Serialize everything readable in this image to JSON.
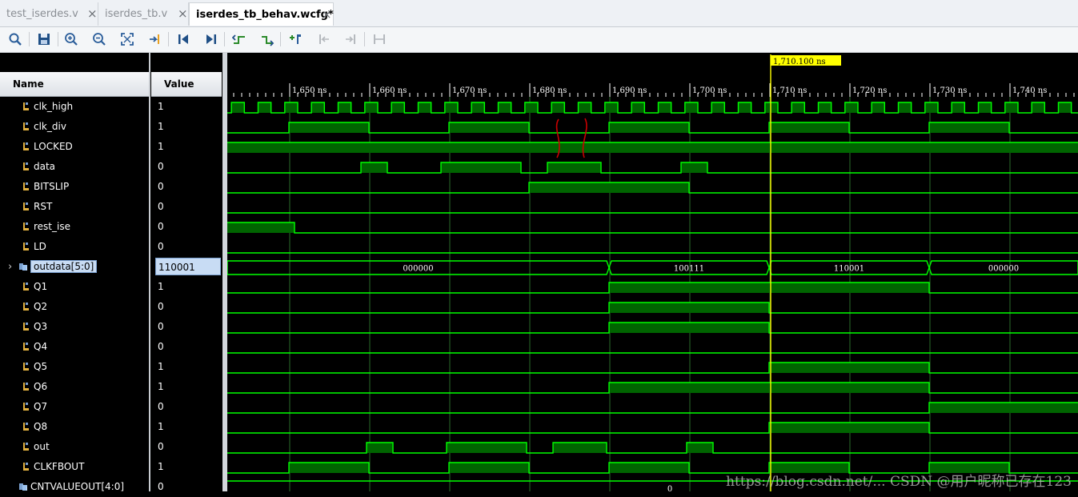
{
  "tabs": [
    {
      "label": "test_iserdes.v"
    },
    {
      "label": "iserdes_tb.v"
    },
    {
      "label": "iserdes_tb_behav.wcfg*"
    }
  ],
  "tab_close_glyph": "×",
  "toolbar_icons": [
    "search-icon",
    "save-icon",
    "zoom-in-icon",
    "zoom-out-icon",
    "zoom-fit-icon",
    "go-to-cursor-icon",
    "go-to-time-0-icon",
    "go-to-last-time-icon",
    "previous-transition-icon",
    "next-transition-icon",
    "add-marker-icon",
    "previous-marker-icon",
    "next-marker-icon",
    "swap-cursors-icon"
  ],
  "columns": {
    "name": "Name",
    "value": "Value"
  },
  "signals": [
    {
      "name": "clk_high",
      "value": "1"
    },
    {
      "name": "clk_div",
      "value": "1"
    },
    {
      "name": "LOCKED",
      "value": "1"
    },
    {
      "name": "data",
      "value": "0"
    },
    {
      "name": "BITSLIP",
      "value": "0"
    },
    {
      "name": "RST",
      "value": "0"
    },
    {
      "name": "rest_ise",
      "value": "0"
    },
    {
      "name": "LD",
      "value": "0"
    },
    {
      "name": "outdata[5:0]",
      "value": "110001"
    },
    {
      "name": "Q1",
      "value": "1"
    },
    {
      "name": "Q2",
      "value": "0"
    },
    {
      "name": "Q3",
      "value": "0"
    },
    {
      "name": "Q4",
      "value": "0"
    },
    {
      "name": "Q5",
      "value": "1"
    },
    {
      "name": "Q6",
      "value": "1"
    },
    {
      "name": "Q7",
      "value": "0"
    },
    {
      "name": "Q8",
      "value": "1"
    },
    {
      "name": "out",
      "value": "0"
    },
    {
      "name": "CLKFBOUT",
      "value": "1"
    },
    {
      "name": "CNTVALUEOUT[4:0]",
      "value": "0"
    }
  ],
  "expand_glyph": "›",
  "timeline": {
    "ticks_ns": [
      1650,
      1660,
      1670,
      1680,
      1690,
      1700,
      1710,
      1720,
      1730,
      1740
    ],
    "tick_labels": [
      "1,650 ns",
      "1,660 ns",
      "1,670 ns",
      "1,680 ns",
      "1,690 ns",
      "1,700 ns",
      "1,710 ns",
      "1,720 ns",
      "1,730 ns",
      "1,740 ns"
    ],
    "cursor_ns": 1710.1,
    "cursor_label": "1,710.100 ns"
  },
  "bus_segments": [
    {
      "from_ns": 1642.2,
      "to_ns": 1689.9,
      "value": "000000"
    },
    {
      "from_ns": 1689.9,
      "to_ns": 1709.9,
      "value": "100111"
    },
    {
      "from_ns": 1709.9,
      "to_ns": 1729.9,
      "value": "110001"
    },
    {
      "from_ns": 1729.9,
      "to_ns": 1748.5,
      "value": "000000"
    }
  ],
  "cntvalueout_label": "0",
  "watermark": "https://blog.csdn.net/... CSDN @用户昵称已存在123",
  "colors": {
    "wave": "#00ff00",
    "wave_fill": "#006400",
    "grid": "#2a6b2a",
    "cursor": "#ffff00",
    "annotation": "#cc0000"
  }
}
